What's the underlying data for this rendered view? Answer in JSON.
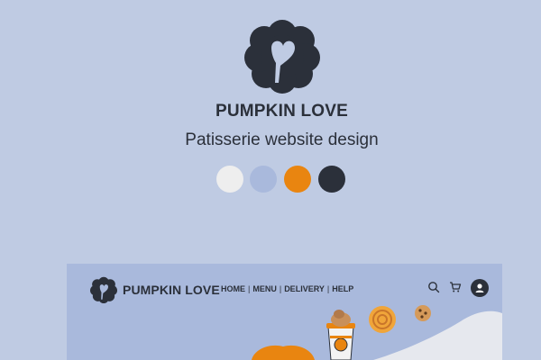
{
  "hero": {
    "brand": "PUMPKIN LOVE",
    "subtitle": "Patisserie website design"
  },
  "palette": [
    "#eeeeee",
    "#a9b9dc",
    "#e98510",
    "#2b303a"
  ],
  "mockup": {
    "brand": "PUMPKIN LOVE",
    "nav": [
      "HOME",
      "MENU",
      "DELIVERY",
      "HELP"
    ],
    "nav_separator": "|",
    "icons": [
      "search-icon",
      "cart-icon",
      "user-icon"
    ]
  }
}
